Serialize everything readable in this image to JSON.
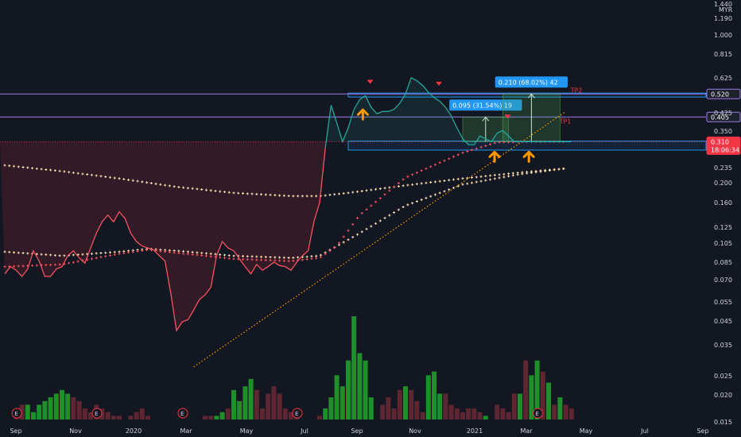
{
  "chart_data": {
    "type": "line",
    "currency": "MYR",
    "y_scale": "log",
    "ylim": [
      0.015,
      1.44
    ],
    "grid": false,
    "y_ticks": [
      "1.440",
      "1.190",
      "1.000",
      "0.815",
      "0.625",
      "0.425",
      "0.350",
      "0.235",
      "0.200",
      "0.160",
      "0.125",
      "0.105",
      "0.085",
      "0.070",
      "0.055",
      "0.045",
      "0.035",
      "0.025",
      "0.020",
      "0.015"
    ],
    "x_ticks": [
      "Sep",
      "Nov",
      "2020",
      "Mar",
      "May",
      "Jul",
      "Sep",
      "Nov",
      "2021",
      "Mar",
      "May",
      "Jul",
      "Sep"
    ],
    "price_series": {
      "name": "Price",
      "x": [
        0,
        1,
        2,
        3,
        4,
        5,
        6,
        7,
        8,
        9,
        10,
        11,
        12,
        13,
        14,
        15,
        16,
        17,
        18,
        19,
        20,
        21,
        22,
        23,
        24,
        25,
        26,
        27,
        28,
        29,
        30,
        31,
        32,
        33,
        34,
        35,
        36,
        37,
        38,
        39,
        40,
        41,
        42,
        43,
        44,
        45,
        46,
        47,
        48,
        49,
        50,
        51,
        52,
        53,
        54,
        55,
        56,
        57,
        58,
        59,
        60,
        61,
        62,
        63,
        64,
        65,
        66,
        67,
        68,
        69,
        70,
        71,
        72,
        73,
        74,
        75,
        76,
        77,
        78,
        79,
        80,
        81,
        82,
        83,
        84,
        85,
        86,
        87,
        88,
        89,
        90,
        91,
        92,
        93,
        94,
        95,
        96,
        97,
        98,
        99
      ],
      "y": [
        0.074,
        0.08,
        0.077,
        0.072,
        0.078,
        0.095,
        0.085,
        0.072,
        0.072,
        0.078,
        0.08,
        0.09,
        0.095,
        0.088,
        0.083,
        0.098,
        0.115,
        0.13,
        0.14,
        0.13,
        0.145,
        0.135,
        0.115,
        0.105,
        0.1,
        0.098,
        0.096,
        0.09,
        0.085,
        0.06,
        0.04,
        0.044,
        0.045,
        0.05,
        0.056,
        0.059,
        0.064,
        0.09,
        0.105,
        0.098,
        0.095,
        0.087,
        0.08,
        0.074,
        0.082,
        0.077,
        0.08,
        0.084,
        0.081,
        0.08,
        0.077,
        0.084,
        0.09,
        0.095,
        0.13,
        0.16,
        0.29,
        0.46,
        0.38,
        0.31,
        0.36,
        0.44,
        0.49,
        0.51,
        0.45,
        0.42,
        0.43,
        0.43,
        0.44,
        0.47,
        0.52,
        0.62,
        0.6,
        0.57,
        0.53,
        0.5,
        0.48,
        0.45,
        0.41,
        0.36,
        0.32,
        0.3,
        0.3,
        0.33,
        0.32,
        0.31,
        0.34,
        0.35,
        0.33,
        0.31,
        0.31,
        0.31,
        0.31,
        0.31,
        0.31,
        0.31,
        0.31,
        0.31,
        0.31,
        0.31
      ]
    },
    "ma_series": [
      {
        "name": "",
        "color": "#ffe0b2",
        "x": [
          0,
          10,
          20,
          30,
          40,
          50,
          55,
          60,
          70,
          80,
          90,
          98
        ],
        "y": [
          0.24,
          0.225,
          0.208,
          0.19,
          0.178,
          0.172,
          0.172,
          0.178,
          0.193,
          0.208,
          0.222,
          0.232
        ]
      },
      {
        "name": "",
        "color": "#ffe0b2",
        "x": [
          0,
          10,
          20,
          25,
          30,
          40,
          50,
          55,
          58,
          62,
          70,
          80,
          90,
          98
        ],
        "y": [
          0.094,
          0.09,
          0.094,
          0.097,
          0.095,
          0.09,
          0.088,
          0.09,
          0.1,
          0.115,
          0.155,
          0.195,
          0.218,
          0.232
        ]
      },
      {
        "name": "",
        "color": "#f7525f",
        "x": [
          0,
          10,
          20,
          25,
          30,
          40,
          50,
          55,
          58,
          62,
          70,
          80,
          86,
          92,
          98
        ],
        "y": [
          0.08,
          0.082,
          0.092,
          0.096,
          0.093,
          0.087,
          0.085,
          0.088,
          0.1,
          0.14,
          0.21,
          0.275,
          0.308,
          0.31,
          0.31
        ]
      }
    ],
    "trendline": {
      "color": "#ff9800",
      "x": [
        33,
        98
      ],
      "y": [
        0.027,
        0.43
      ]
    },
    "horizontal_levels": [
      {
        "value": 0.52,
        "label": "0.520",
        "color": "#9c7ce8"
      },
      {
        "value": 0.405,
        "label": "0.405",
        "color": "#9c7ce8"
      },
      {
        "value": 0.31,
        "label": "0.310",
        "sublabel": "18:06:34",
        "color": "#f23645"
      }
    ],
    "zones": [
      {
        "from": 0.503,
        "to": 0.525,
        "color": "#2196f3"
      },
      {
        "from": 0.283,
        "to": 0.312,
        "color": "#2196f3"
      }
    ],
    "targets": [
      {
        "label": "TP1",
        "box": "0.095 (31.54%) 19",
        "from": 0.31,
        "to": 0.405
      },
      {
        "label": "TP2",
        "box": "0.210 (68.02%) 42",
        "from": 0.31,
        "to": 0.52
      }
    ],
    "sell_markers_x": [
      63,
      75,
      87
    ],
    "buy_markers_x": [
      62,
      85,
      91
    ],
    "earnings_markers_x": [
      1,
      15,
      30,
      50,
      92
    ],
    "earnings_label": "E",
    "volume": [
      0,
      0,
      2,
      4,
      4,
      2,
      4,
      5,
      6,
      7,
      8,
      7,
      6,
      5,
      3,
      2,
      4,
      3,
      2,
      1,
      1,
      0,
      1,
      2,
      3,
      1,
      0,
      0,
      0,
      0,
      0,
      0,
      0,
      0,
      0,
      1,
      1,
      1,
      2,
      3,
      8,
      5,
      9,
      11,
      8,
      3,
      7,
      9,
      7,
      3,
      2,
      2,
      0,
      0,
      0,
      1,
      3,
      6,
      12,
      9,
      16,
      28,
      18,
      16,
      6,
      0,
      4,
      6,
      3,
      8,
      9,
      8,
      5,
      2,
      12,
      13,
      7,
      7,
      4,
      3,
      2,
      3,
      3,
      2,
      1,
      0,
      4,
      3,
      2,
      7,
      7,
      16,
      12,
      16,
      13,
      10,
      4,
      6,
      4,
      3
    ],
    "volume_colors_up": [
      4,
      5,
      6,
      7,
      8,
      9,
      10,
      11,
      37,
      38,
      40,
      41,
      42,
      43,
      56,
      57,
      58,
      59,
      60,
      61,
      62,
      63,
      64,
      70,
      74,
      75,
      76,
      84,
      90,
      92,
      93,
      95,
      97
    ],
    "volume_max": 28
  }
}
